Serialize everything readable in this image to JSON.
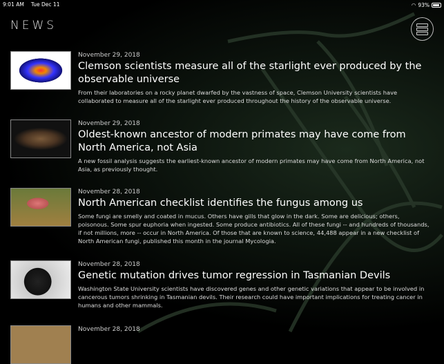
{
  "status": {
    "time": "9:01 AM",
    "date": "Tue Dec 11",
    "battery": "93%",
    "battery_level": 0.93
  },
  "header": {
    "title": "NEWS"
  },
  "articles": [
    {
      "date": "November 29, 2018",
      "title": "Clemson scientists measure all of the starlight ever produced by the observable universe",
      "summary": "From their laboratories on a rocky planet dwarfed by the vastness of space, Clemson University scientists have collaborated to measure all of the starlight ever produced throughout the history of the observable universe."
    },
    {
      "date": "November 29, 2018",
      "title": "Oldest-known ancestor of modern primates may have come from North America, not Asia",
      "summary": "A new fossil analysis suggests the earliest-known ancestor of modern primates may have come from North America, not Asia, as previously thought."
    },
    {
      "date": "November 28, 2018",
      "title": "North American checklist identifies the fungus among us",
      "summary": "Some fungi are smelly and coated in mucus. Others have gills that glow in the dark. Some are delicious; others, poisonous. Some spur euphoria when ingested. Some produce antibiotics. All of these fungi -- and hundreds of thousands, if not millions, more -- occur in North America. Of those that are known to science, 44,488 appear in a new checklist of North American fungi, published this month in the journal Mycologia."
    },
    {
      "date": "November 28, 2018",
      "title": "Genetic mutation drives tumor regression in Tasmanian Devils",
      "summary": "Washington State University scientists have discovered genes and other genetic variations that appear to be involved in cancerous tumors shrinking in Tasmanian devils. Their research could have important implications for treating cancer in humans and other mammals."
    },
    {
      "date": "November 28, 2018"
    }
  ]
}
